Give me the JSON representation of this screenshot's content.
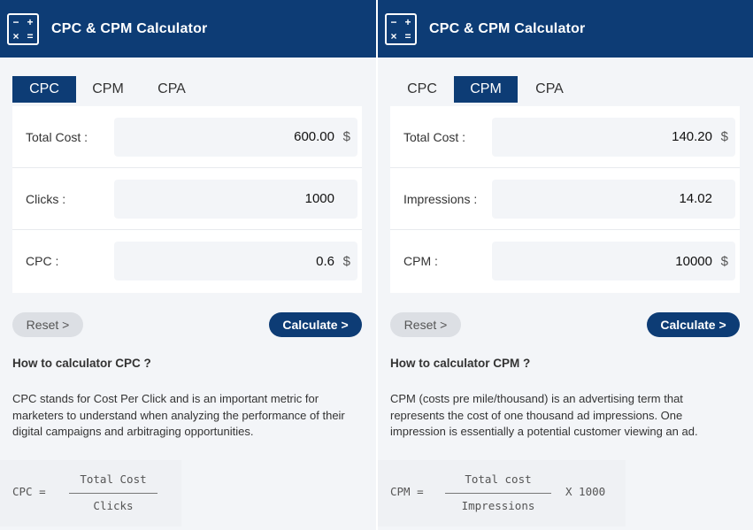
{
  "left": {
    "title": "CPC & CPM Calculator",
    "tabs": [
      "CPC",
      "CPM",
      "CPA"
    ],
    "active_tab": 0,
    "rows": [
      {
        "label": "Total Cost :",
        "value": "600.00",
        "unit": "$"
      },
      {
        "label": "Clicks :",
        "value": "1000",
        "unit": ""
      },
      {
        "label": "CPC :",
        "value": "0.6",
        "unit": "$"
      }
    ],
    "reset_label": "Reset >",
    "calculate_label": "Calculate >",
    "how_title": "How to calculator CPC ?",
    "how_desc": "CPC stands for Cost Per Click and is an important metric for marketers to understand when analyzing the performance of their digital campaigns and arbitraging opportunities.",
    "formula": {
      "lhs": "CPC  =",
      "numerator": "Total Cost",
      "denominator": "Clicks",
      "tail": ""
    }
  },
  "right": {
    "title": "CPC & CPM Calculator",
    "tabs": [
      "CPC",
      "CPM",
      "CPA"
    ],
    "active_tab": 1,
    "rows": [
      {
        "label": "Total Cost :",
        "value": "140.20",
        "unit": "$"
      },
      {
        "label": "Impressions :",
        "value": "14.02",
        "unit": ""
      },
      {
        "label": "CPM :",
        "value": "10000",
        "unit": "$"
      }
    ],
    "reset_label": "Reset >",
    "calculate_label": "Calculate >",
    "how_title": "How to calculator CPM ?",
    "how_desc": "CPM (costs pre mile/thousand) is an advertising term that represents the cost of one thousand ad impressions. One impression is essentially a potential customer viewing an ad.",
    "formula": {
      "lhs": "CPM  =",
      "numerator": "Total cost",
      "denominator": "Impressions",
      "tail": "X 1000"
    }
  },
  "icons": {
    "logo": "calculator-icon"
  },
  "colors": {
    "brand": "#0d3c75",
    "background": "#f3f5f8",
    "reset_button": "#dcdfe4"
  }
}
